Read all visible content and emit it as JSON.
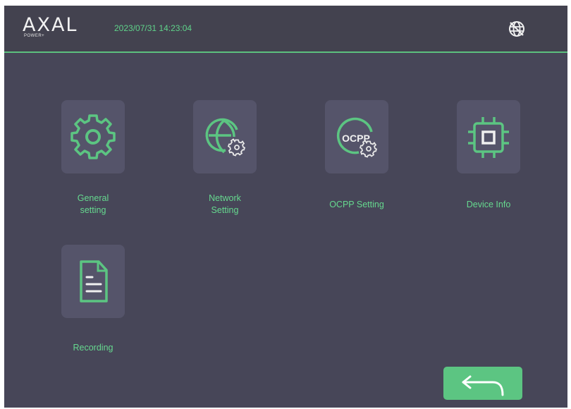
{
  "header": {
    "logo_text": "AXAL",
    "logo_sub": "POWER+",
    "datetime": "2023/07/31 14:23:04",
    "network_status_icon": "globe-no-connection-icon"
  },
  "menu": {
    "items": [
      {
        "id": "general",
        "label_line1": "General",
        "label_line2": "setting",
        "icon": "gear-icon"
      },
      {
        "id": "network",
        "label_line1": "Network",
        "label_line2": "Setting",
        "icon": "globe-gear-icon"
      },
      {
        "id": "ocpp",
        "label_line1": "OCPP Setting",
        "label_line2": "",
        "icon": "ocpp-gear-icon"
      },
      {
        "id": "device",
        "label_line1": "Device Info",
        "label_line2": "",
        "icon": "chip-icon"
      },
      {
        "id": "recording",
        "label_line1": "Recording",
        "label_line2": "",
        "icon": "document-icon"
      }
    ],
    "ocpp_icon_text": "OCPP"
  },
  "footer": {
    "back_icon": "return-arrow-icon"
  },
  "colors": {
    "background": "#474658",
    "header": "#43424f",
    "tile": "#55546a",
    "accent": "#5cc582",
    "label": "#66d98f"
  }
}
